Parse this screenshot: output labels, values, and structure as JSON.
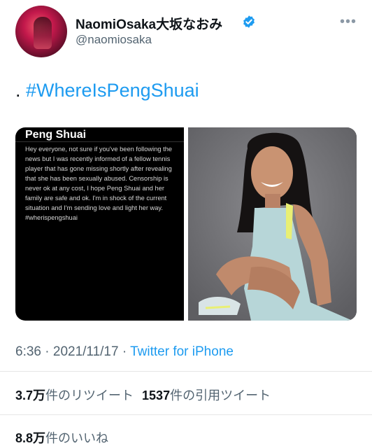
{
  "user": {
    "display_name": "NaomiOsaka大坂なおみ",
    "handle": "@naomiosaka",
    "verified": true,
    "avatar_icon": "profile-photo"
  },
  "menu": {
    "more_label": "•••"
  },
  "tweet": {
    "prefix": ". ",
    "hashtag": "#WhereIsPengShuai",
    "hashtag_color": "#1d9bf0"
  },
  "media": {
    "screenshot_title": "Peng Shuai",
    "screenshot_body": "Hey everyone, not sure if you've been following the news but I was recently informed of a fellow tennis player that has gone missing shortly after revealing that she has been sexually abused. Censorship is never ok at any cost, I hope Peng Shuai and her family are safe and ok. I'm in shock of the current situation and I'm sending love and light her way. #wherispengshuai",
    "photo_icon": "photo-of-tennis-player"
  },
  "meta": {
    "time": "6:36",
    "separator": " · ",
    "date": "2021/11/17",
    "source": "Twitter for iPhone"
  },
  "stats": {
    "retweets_count": "3.7万",
    "retweets_label": "件のリツイート",
    "quotes_count": "1537",
    "quotes_label": "件の引用ツイート",
    "likes_count": "8.8万",
    "likes_label": "件のいいね"
  },
  "colors": {
    "link": "#1d9bf0",
    "secondary_text": "#536471",
    "primary_text": "#0f1419"
  }
}
